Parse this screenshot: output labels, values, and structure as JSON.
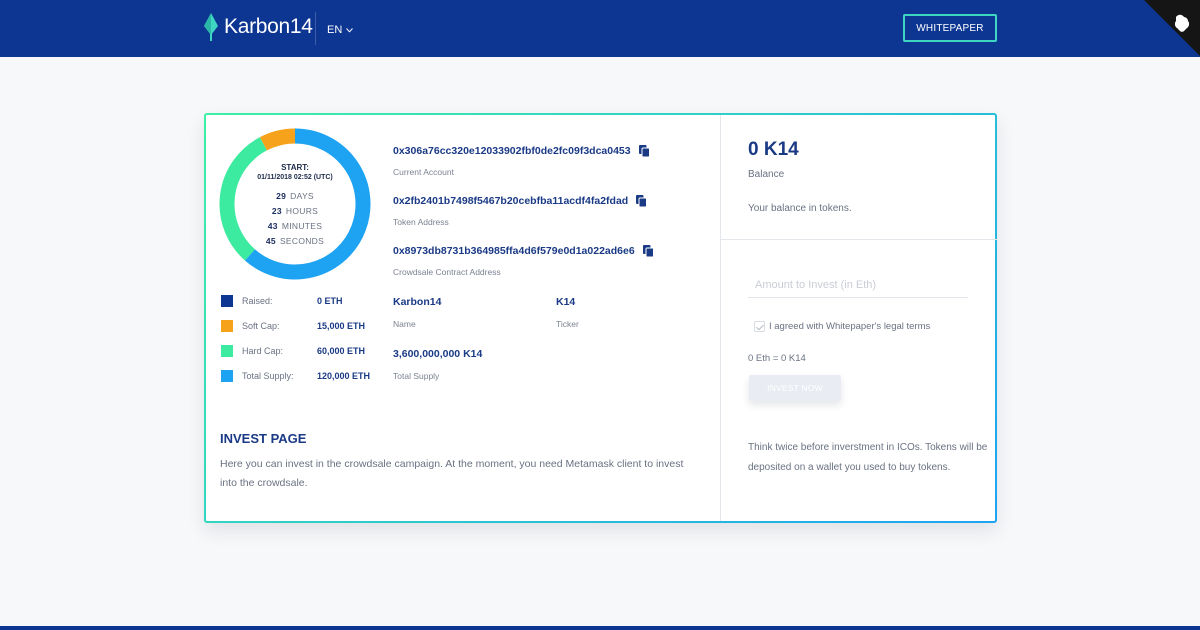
{
  "header": {
    "brand": "Karbon14",
    "language": "EN",
    "whitepaper_label": "WHITEPAPER"
  },
  "countdown": {
    "start_label": "START:",
    "start_date": "01/11/2018 02:52 (UTC)",
    "rows": [
      {
        "value": "29",
        "unit": "DAYS"
      },
      {
        "value": "23",
        "unit": "HOURS"
      },
      {
        "value": "43",
        "unit": "MINUTES"
      },
      {
        "value": "45",
        "unit": "SECONDS"
      }
    ]
  },
  "legend": [
    {
      "label": "Raised:",
      "value": "0 ETH",
      "color": "#0d3592"
    },
    {
      "label": "Soft Cap:",
      "value": "15,000 ETH",
      "color": "#f7a21b"
    },
    {
      "label": "Hard Cap:",
      "value": "60,000 ETH",
      "color": "#3ceb9f"
    },
    {
      "label": "Total Supply:",
      "value": "120,000 ETH",
      "color": "#1ea3f3"
    }
  ],
  "addresses": [
    {
      "address": "0x306a76cc320e12033902fbf0de2fc09f3dca0453",
      "caption": "Current Account"
    },
    {
      "address": "0x2fb2401b7498f5467b20cebfba11acdf4fa2fdad",
      "caption": "Token Address"
    },
    {
      "address": "0x8973db8731b364985ffa4d6f579e0d1a022ad6e6",
      "caption": "Crowdsale Contract Address"
    }
  ],
  "token": {
    "name": "Karbon14",
    "name_label": "Name",
    "ticker": "K14",
    "ticker_label": "Ticker",
    "supply": "3,600,000,000 K14",
    "supply_label": "Total Supply"
  },
  "invest_info": {
    "title": "INVEST PAGE",
    "description": "Here you can invest in the crowdsale campaign. At the moment, you need Metamask client to invest into the crowdsale."
  },
  "balance": {
    "amount": "0 K14",
    "label": "Balance",
    "description": "Your balance in tokens."
  },
  "invest_form": {
    "amount_placeholder": "Amount to Invest (in Eth)",
    "agree_label": "I agreed with Whitepaper's legal terms",
    "conversion": "0 Eth = 0 K14",
    "button_label": "INVEST NOW",
    "warning": "Think twice before inverstment in ICOs. Tokens will be deposited on a wallet you used to buy tokens."
  },
  "chart_data": {
    "type": "pie",
    "categories": [
      "Raised",
      "Soft Cap",
      "Hard Cap",
      "Total Supply"
    ],
    "values": [
      0,
      15000,
      60000,
      120000
    ],
    "colors": [
      "#0d3592",
      "#f7a21b",
      "#3ceb9f",
      "#1ea3f3"
    ]
  }
}
